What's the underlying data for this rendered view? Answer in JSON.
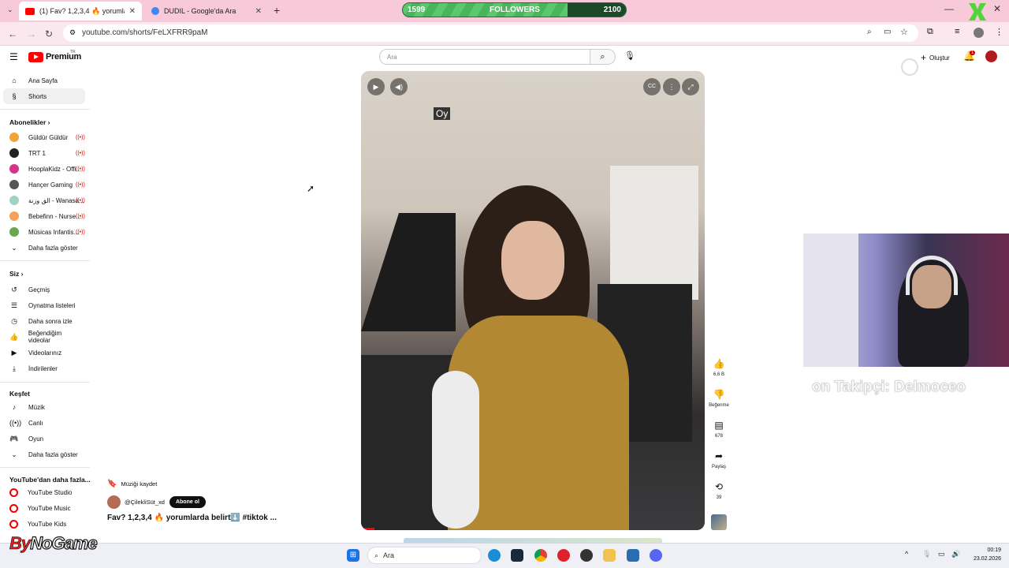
{
  "browser": {
    "tabs": [
      {
        "title": "(1) Fav? 1,2,3,4 🔥 yorumlarda b",
        "active": true
      },
      {
        "title": "DUDIL - Google'da Ara",
        "active": false
      }
    ],
    "new_tab": "+",
    "url": "youtube.com/shorts/FeLXFRR9paM"
  },
  "followers_bar": {
    "current": "1599",
    "label": "FOLLOWERS",
    "goal": "2100",
    "progress": 0.74
  },
  "youtube": {
    "logo_text": "Premium",
    "logo_region": "TR",
    "search_placeholder": "Ara",
    "create_label": "Oluştur",
    "notification_count": "1"
  },
  "sidebar": {
    "main": [
      {
        "label": "Ana Sayfa",
        "icon": "home-icon"
      },
      {
        "label": "Shorts",
        "icon": "shorts-icon"
      }
    ],
    "subs_header": "Abonelikler",
    "subscriptions": [
      {
        "label": "Güldür Güldür",
        "color": "#f2a33a"
      },
      {
        "label": "TRT 1",
        "color": "#222222"
      },
      {
        "label": "HooplaKidz - Offi...",
        "color": "#d8338a"
      },
      {
        "label": "Hançer Gaming",
        "color": "#555555"
      },
      {
        "label": "الق وزنة - Wanasa...",
        "color": "#9fd3c7"
      },
      {
        "label": "Bebefinn - Nurse...",
        "color": "#f4a259"
      },
      {
        "label": "Músicas Infantis...",
        "color": "#6aa84f"
      }
    ],
    "subs_more": "Daha fazla göster",
    "you_header": "Siz",
    "you_items": [
      {
        "label": "Geçmiş",
        "icon": "history-icon"
      },
      {
        "label": "Oynatma listeleri",
        "icon": "playlist-icon"
      },
      {
        "label": "Daha sonra izle",
        "icon": "clock-icon"
      },
      {
        "label": "Beğendiğim videolar",
        "icon": "thumbs-up-icon"
      },
      {
        "label": "Videolarınız",
        "icon": "video-icon"
      },
      {
        "label": "İndirilenler",
        "icon": "download-icon"
      }
    ],
    "explore_header": "Keşfet",
    "explore_items": [
      {
        "label": "Müzik",
        "icon": "music-icon"
      },
      {
        "label": "Canlı",
        "icon": "live-icon"
      },
      {
        "label": "Oyun",
        "icon": "gamepad-icon"
      },
      {
        "label": "Daha fazla göster",
        "icon": "chevron-down-icon"
      }
    ],
    "more_header": "YouTube'dan daha fazla...",
    "more_items": [
      {
        "label": "YouTube Studio"
      },
      {
        "label": "YouTube Music"
      },
      {
        "label": "YouTube Kids"
      }
    ]
  },
  "video": {
    "caption": "Oy",
    "save_music": "Müziği kaydet",
    "channel": "@ÇilekliSüt_xd",
    "subscribe": "Abone ol",
    "title": "Fav? 1,2,3,4 🔥 yorumlarda belirt⬇️ #tiktok ...",
    "progress": 0.04
  },
  "actions": [
    {
      "icon": "like-icon",
      "label": "6,6 B"
    },
    {
      "icon": "dislike-icon",
      "label": "Beğenme"
    },
    {
      "icon": "comment-icon",
      "label": "678"
    },
    {
      "icon": "share-icon",
      "label": "Paylaş"
    },
    {
      "icon": "remix-icon",
      "label": "39"
    }
  ],
  "overlay": {
    "ticker": "on Takipçi: Delmoceo",
    "watermark_a": "By",
    "watermark_b": "NoGame"
  },
  "taskbar": {
    "search": "Ara",
    "time": "00:19",
    "date": "23.02.2026"
  }
}
